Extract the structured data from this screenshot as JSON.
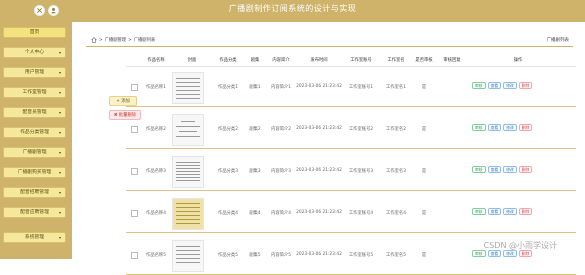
{
  "header": {
    "title": "广播剧制作订阅系统的设计与实现"
  },
  "sidebar": {
    "items": [
      {
        "label": "首页"
      },
      {
        "label": "个人中心"
      },
      {
        "label": "用户管理"
      },
      {
        "label": "工作室管理"
      },
      {
        "label": "配音员管理"
      },
      {
        "label": "作品分类管理"
      },
      {
        "label": "广播剧管理"
      },
      {
        "label": "广播剧购买管理"
      },
      {
        "label": "配音招聘管理"
      },
      {
        "label": "配音应聘管理"
      },
      {
        "label": "系统管理"
      }
    ]
  },
  "breadcrumb": {
    "parent": "广播剧管理",
    "current": "广播剧列表",
    "sep": ">"
  },
  "page_title_right": "广播剧列表",
  "actions": {
    "add": "添加",
    "batch_delete": "批量删除"
  },
  "table": {
    "headers": [
      "作品名称",
      "封面",
      "作品分类",
      "剧集",
      "内容简介",
      "发布时间",
      "工作室账号",
      "工作室名",
      "是否审核",
      "审核回复",
      "操作"
    ],
    "rows": [
      {
        "name": "作品名称1",
        "category": "作品分类1",
        "episodes": "剧集1",
        "intro": "内容简介1",
        "time": "2023-03-06 21:23:42",
        "studio_acct": "工作室账号1",
        "studio_name": "工作室名1",
        "audited": "是",
        "reply": ""
      },
      {
        "name": "作品名称2",
        "category": "作品分类2",
        "episodes": "剧集2",
        "intro": "内容简介2",
        "time": "2023-03-06 21:23:42",
        "studio_acct": "工作室账号2",
        "studio_name": "工作室名2",
        "audited": "是",
        "reply": ""
      },
      {
        "name": "作品名称3",
        "category": "作品分类3",
        "episodes": "剧集3",
        "intro": "内容简介3",
        "time": "2023-03-06 21:23:42",
        "studio_acct": "工作室账号3",
        "studio_name": "工作室名3",
        "audited": "是",
        "reply": ""
      },
      {
        "name": "作品名称4",
        "category": "作品分类4",
        "episodes": "剧集4",
        "intro": "内容简介4",
        "time": "2023-03-06 21:23:42",
        "studio_acct": "工作室账号4",
        "studio_name": "工作室名4",
        "audited": "是",
        "reply": ""
      },
      {
        "name": "作品名称5",
        "category": "作品分类5",
        "episodes": "剧集5",
        "intro": "内容简介5",
        "time": "2023-03-06 21:23:42",
        "studio_acct": "工作室账号5",
        "studio_name": "工作室名5",
        "audited": "是",
        "reply": ""
      }
    ],
    "ops": {
      "review": "审核",
      "view": "查看",
      "edit": "修改",
      "delete": "删除"
    }
  },
  "watermark": "CSDN @小雨学设计",
  "colors": {
    "accent": "#cfb36a",
    "menu_bg": "#f5e89a",
    "row_line": "#dcc384"
  }
}
